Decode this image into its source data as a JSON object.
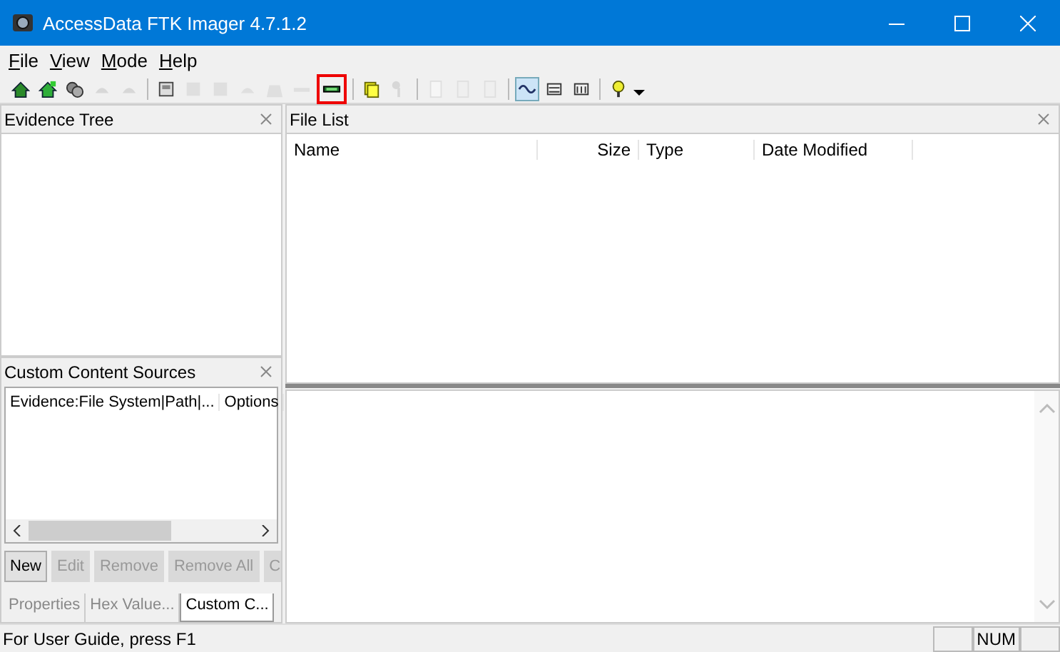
{
  "window": {
    "title": "AccessData FTK Imager 4.7.1.2"
  },
  "menu": [
    {
      "label": "File"
    },
    {
      "label": "View"
    },
    {
      "label": "Mode"
    },
    {
      "label": "Help"
    }
  ],
  "toolbar": [
    {
      "kind": "icon",
      "disabled": false,
      "selected": false,
      "highlighted": false
    },
    {
      "kind": "icon",
      "disabled": false,
      "selected": false,
      "highlighted": false
    },
    {
      "kind": "icon",
      "disabled": false,
      "selected": false,
      "highlighted": false
    },
    {
      "kind": "icon",
      "disabled": true,
      "selected": false,
      "highlighted": false
    },
    {
      "kind": "icon",
      "disabled": true,
      "selected": false,
      "highlighted": false
    },
    {
      "kind": "separator"
    },
    {
      "kind": "icon",
      "disabled": false,
      "selected": false,
      "highlighted": false
    },
    {
      "kind": "icon",
      "disabled": true,
      "selected": false,
      "highlighted": false
    },
    {
      "kind": "icon",
      "disabled": true,
      "selected": false,
      "highlighted": false
    },
    {
      "kind": "icon",
      "disabled": true,
      "selected": false,
      "highlighted": false
    },
    {
      "kind": "icon",
      "disabled": true,
      "selected": false,
      "highlighted": false
    },
    {
      "kind": "icon",
      "disabled": true,
      "selected": false,
      "highlighted": false
    },
    {
      "kind": "icon",
      "disabled": false,
      "selected": false,
      "highlighted": true
    },
    {
      "kind": "separator"
    },
    {
      "kind": "icon",
      "disabled": false,
      "selected": false,
      "highlighted": false
    },
    {
      "kind": "icon",
      "disabled": true,
      "selected": false,
      "highlighted": false
    },
    {
      "kind": "separator"
    },
    {
      "kind": "icon",
      "disabled": true,
      "selected": false,
      "highlighted": false
    },
    {
      "kind": "icon",
      "disabled": true,
      "selected": false,
      "highlighted": false
    },
    {
      "kind": "icon",
      "disabled": true,
      "selected": false,
      "highlighted": false
    },
    {
      "kind": "separator"
    },
    {
      "kind": "icon",
      "disabled": false,
      "selected": true,
      "highlighted": false
    },
    {
      "kind": "icon",
      "disabled": false,
      "selected": false,
      "highlighted": false
    },
    {
      "kind": "icon",
      "disabled": false,
      "selected": false,
      "highlighted": false
    },
    {
      "kind": "separator"
    },
    {
      "kind": "icon",
      "disabled": false,
      "selected": false,
      "highlighted": false
    },
    {
      "kind": "dropdown"
    }
  ],
  "evidence_tree": {
    "title": "Evidence Tree"
  },
  "custom_content_sources": {
    "title": "Custom Content Sources",
    "columns": [
      "Evidence:File System|Path|...",
      "Options"
    ],
    "buttons": [
      {
        "label": "New",
        "disabled": false
      },
      {
        "label": "Edit",
        "disabled": true
      },
      {
        "label": "Remove",
        "disabled": true
      },
      {
        "label": "Remove All",
        "disabled": true
      },
      {
        "label": "C",
        "disabled": true
      }
    ]
  },
  "bottom_tabs": [
    {
      "label": "Properties",
      "selected": false
    },
    {
      "label": "Hex Value...",
      "selected": false
    },
    {
      "label": "Custom C...",
      "selected": true
    }
  ],
  "file_list": {
    "title": "File List",
    "columns": [
      {
        "label": "Name",
        "kind": "text"
      },
      {
        "label": "Size",
        "kind": "number"
      },
      {
        "label": "Type",
        "kind": "text"
      },
      {
        "label": "Date Modified",
        "kind": "text"
      }
    ]
  },
  "status_bar": {
    "text": "For User Guide, press F1",
    "panes": [
      "NUM"
    ]
  }
}
